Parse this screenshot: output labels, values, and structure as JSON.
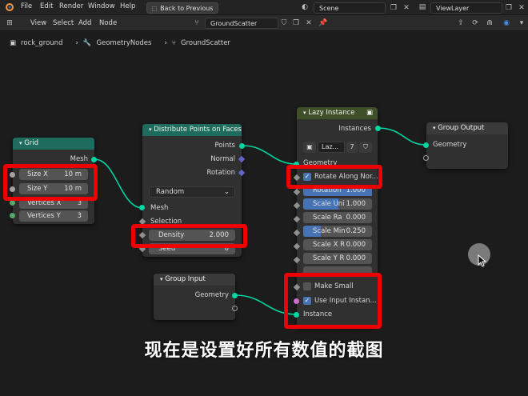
{
  "menu": {
    "file": "File",
    "edit": "Edit",
    "render": "Render",
    "window": "Window",
    "help": "Help"
  },
  "topbar": {
    "back_label": "Back to Previous",
    "scene": "Scene",
    "view_layer": "ViewLayer"
  },
  "editor_menu": {
    "view": "View",
    "select": "Select",
    "add": "Add",
    "node": "Node",
    "node_tree": "GroundScatter"
  },
  "breadcrumb": {
    "object": "rock_ground",
    "modifier": "GeometryNodes",
    "tree": "GroundScatter"
  },
  "nodes": {
    "grid": {
      "title": "Grid",
      "mesh": "Mesh",
      "size_x_label": "Size X",
      "size_x_value": "10 m",
      "size_y_label": "Size Y",
      "size_y_value": "10 m",
      "vx_label": "Vertices X",
      "vx_value": "3",
      "vy_label": "Vertices Y",
      "vy_value": "3"
    },
    "distribute": {
      "title": "Distribute Points on Faces",
      "points": "Points",
      "normal": "Normal",
      "rotation": "Rotation",
      "mode": "Random",
      "mesh": "Mesh",
      "selection": "Selection",
      "density_label": "Density",
      "density_value": "2.000",
      "seed_label": "Seed",
      "seed_value": "0"
    },
    "lazy": {
      "title": "Lazy Instance",
      "instances": "Instances",
      "obj_field": "Laz...",
      "user_count": "7",
      "geometry": "Geometry",
      "rotate_along": "Rotate Along Nor...",
      "rotation_label": "Rotation",
      "rotation_value": "1.000",
      "scale_uni_label": "Scale Uni",
      "scale_uni_value": "1.000",
      "scale_ra_label": "Scale Ra",
      "scale_ra_value": "0.000",
      "scale_min_label": "Scale Min",
      "scale_min_value": "0.250",
      "scale_xr_label": "Scale X R",
      "scale_xr_value": "0.000",
      "scale_yr_label": "Scale Y R",
      "scale_yr_value": "0.000",
      "make_small": "Make Small",
      "use_input": "Use Input Instan...",
      "instance": "Instance"
    },
    "group_output": {
      "title": "Group Output",
      "geometry": "Geometry"
    },
    "group_input": {
      "title": "Group Input",
      "geometry": "Geometry"
    }
  },
  "caption": "现在是设置好所有数值的截图",
  "colors": {
    "geometry_socket": "#00d6a3",
    "vector_socket": "#6363c7",
    "highlight": "#ee0000",
    "checkbox_on": "#4772b3"
  }
}
